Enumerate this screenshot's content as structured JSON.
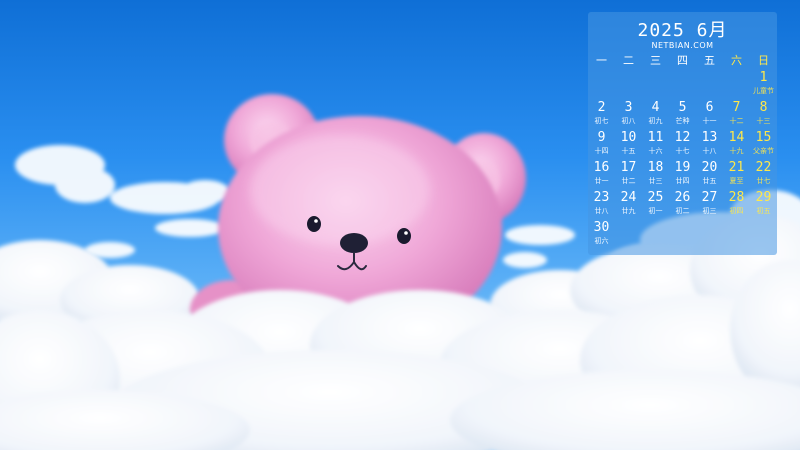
{
  "calendar": {
    "title": "2025 6月",
    "site": "NETBIAN.COM",
    "weekdays": [
      "一",
      "二",
      "三",
      "四",
      "五",
      "六",
      "日"
    ],
    "weeks": [
      [
        null,
        null,
        null,
        null,
        null,
        null,
        {
          "day": "1",
          "lunar": "儿童节"
        }
      ],
      [
        {
          "day": "2",
          "lunar": "初七"
        },
        {
          "day": "3",
          "lunar": "初八"
        },
        {
          "day": "4",
          "lunar": "初九"
        },
        {
          "day": "5",
          "lunar": "芒种"
        },
        {
          "day": "6",
          "lunar": "十一"
        },
        {
          "day": "7",
          "lunar": "十二"
        },
        {
          "day": "8",
          "lunar": "十三"
        }
      ],
      [
        {
          "day": "9",
          "lunar": "十四"
        },
        {
          "day": "10",
          "lunar": "十五"
        },
        {
          "day": "11",
          "lunar": "十六"
        },
        {
          "day": "12",
          "lunar": "十七"
        },
        {
          "day": "13",
          "lunar": "十八"
        },
        {
          "day": "14",
          "lunar": "十九"
        },
        {
          "day": "15",
          "lunar": "父亲节"
        }
      ],
      [
        {
          "day": "16",
          "lunar": "廿一"
        },
        {
          "day": "17",
          "lunar": "廿二"
        },
        {
          "day": "18",
          "lunar": "廿三"
        },
        {
          "day": "19",
          "lunar": "廿四"
        },
        {
          "day": "20",
          "lunar": "廿五"
        },
        {
          "day": "21",
          "lunar": "夏至"
        },
        {
          "day": "22",
          "lunar": "廿七"
        }
      ],
      [
        {
          "day": "23",
          "lunar": "廿八"
        },
        {
          "day": "24",
          "lunar": "廿九"
        },
        {
          "day": "25",
          "lunar": "初一"
        },
        {
          "day": "26",
          "lunar": "初二"
        },
        {
          "day": "27",
          "lunar": "初三"
        },
        {
          "day": "28",
          "lunar": "初四"
        },
        {
          "day": "29",
          "lunar": "初五"
        }
      ],
      [
        {
          "day": "30",
          "lunar": "初六"
        },
        null,
        null,
        null,
        null,
        null,
        null
      ]
    ]
  },
  "colors": {
    "sky_top": "#0f6fd6",
    "sky_bottom": "#9fd2fb",
    "bear_pink": "#f0a8d8",
    "weekend_yellow": "#ffe84a"
  }
}
